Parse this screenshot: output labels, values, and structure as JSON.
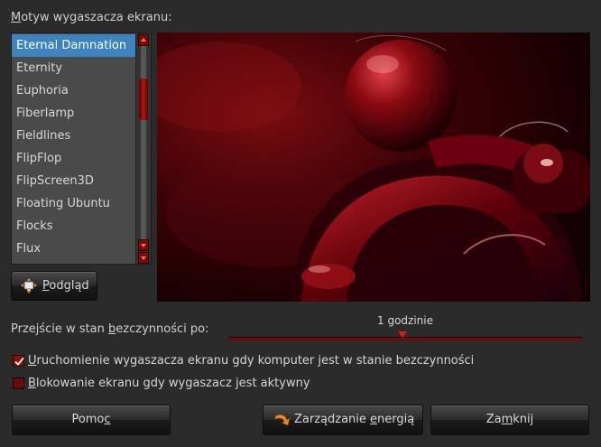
{
  "theme_label_pre": "",
  "theme_label_key": "M",
  "theme_label_rest": "otyw wygaszacza ekranu:",
  "themes": [
    {
      "label": "Eternal Damnation",
      "selected": true
    },
    {
      "label": "Eternity",
      "selected": false
    },
    {
      "label": "Euphoria",
      "selected": false
    },
    {
      "label": "Fiberlamp",
      "selected": false
    },
    {
      "label": "Fieldlines",
      "selected": false
    },
    {
      "label": "FlipFlop",
      "selected": false
    },
    {
      "label": "FlipScreen3D",
      "selected": false
    },
    {
      "label": "Floating Ubuntu",
      "selected": false
    },
    {
      "label": "Flocks",
      "selected": false
    },
    {
      "label": "Flux",
      "selected": false
    }
  ],
  "preview_button": {
    "key": "P",
    "rest": "odgląd",
    "icon": "preview-monitor-icon"
  },
  "idle": {
    "label_pre": "Przejście w stan ",
    "label_key": "b",
    "label_rest": "ezczynności po:",
    "value_text": "1 godzinie",
    "slider_fraction": 0.49
  },
  "activate_checkbox": {
    "checked": true,
    "key": "U",
    "rest": "ruchomienie wygaszacza ekranu gdy komputer jest w stanie bezczynności"
  },
  "lock_checkbox": {
    "checked": false,
    "key": "B",
    "rest": "lokowanie ekranu gdy wygaszacz jest aktywny"
  },
  "buttons": {
    "help": {
      "pre": "Pomo",
      "key": "c",
      "rest": ""
    },
    "power": {
      "pre": "Zarządzanie ",
      "key": "e",
      "rest": "nergią",
      "icon": "power-management-icon"
    },
    "close": {
      "pre": "Za",
      "key": "m",
      "rest": "knij"
    }
  },
  "colors": {
    "accent_selected": "#3c83c0",
    "theme_red": "#b01616",
    "background": "#2b2b2b"
  }
}
